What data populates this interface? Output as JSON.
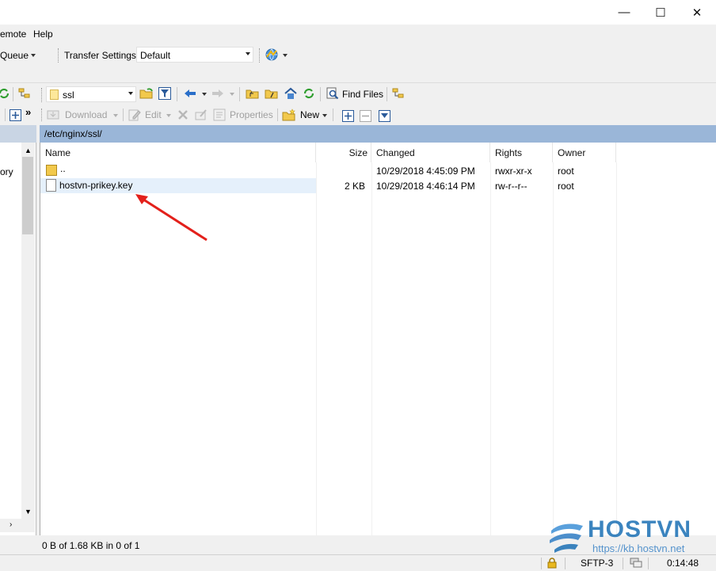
{
  "window": {
    "minimize_glyph": "—",
    "maximize_glyph": "☐",
    "close_glyph": "✕"
  },
  "menu": {
    "items": [
      "emote",
      "Help"
    ]
  },
  "toolbar1": {
    "queue_label": "Queue",
    "transfer_settings_label": "Transfer Settings",
    "transfer_settings_value": "Default"
  },
  "toolbar2": {
    "folder_value": "ssl",
    "find_files_label": "Find Files"
  },
  "toolbar3": {
    "download_label": "Download",
    "edit_label": "Edit",
    "properties_label": "Properties",
    "new_label": "New",
    "more_glyph": "»"
  },
  "left_panel": {
    "partial_label": "ory"
  },
  "remote": {
    "path": "/etc/nginx/ssl/",
    "columns": [
      "Name",
      "Size",
      "Changed",
      "Rights",
      "Owner"
    ],
    "rows": [
      {
        "name": "..",
        "size": "",
        "changed": "10/29/2018 4:45:09 PM",
        "rights": "rwxr-xr-x",
        "owner": "root"
      },
      {
        "name": "hostvn-prikey.key",
        "size": "2 KB",
        "changed": "10/29/2018 4:46:14 PM",
        "rights": "rw-r--r--",
        "owner": "root"
      }
    ]
  },
  "status": {
    "selection": "0 B of 1.68 KB in 0 of 1",
    "protocol": "SFTP-3",
    "elapsed": "0:14:48"
  },
  "watermark": {
    "brand": "HOSTVN",
    "url": "https://kb.hostvn.net"
  },
  "colors": {
    "path_bar": "#9ab6d8",
    "selection": "#e5f0fb",
    "arrow": "#e3201b",
    "brand_blue": "#1a6fb4"
  }
}
